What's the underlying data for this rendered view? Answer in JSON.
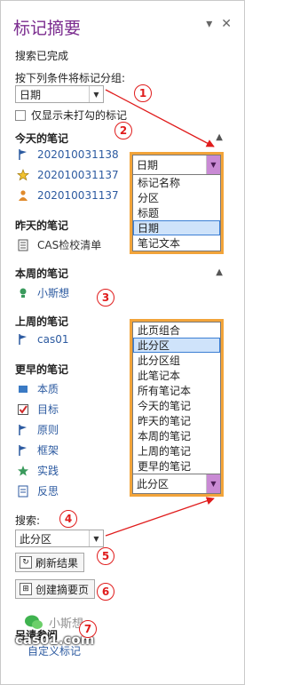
{
  "pane": {
    "title": "标记摘要",
    "pin_glyph": "▾",
    "close_glyph": "✕"
  },
  "status": "搜索已完成",
  "group_by": {
    "label": "按下列条件将标记分组:",
    "value": "日期"
  },
  "unchecked_only_label": "仅显示未打勾的标记",
  "sections": {
    "today": "今天的笔记",
    "yesterday": "昨天的笔记",
    "this_week": "本周的笔记",
    "last_week": "上周的笔记",
    "older": "更早的笔记"
  },
  "today_items": [
    "202010031138",
    "202010031137",
    "202010031137"
  ],
  "yesterday_items": [
    "CAS检校清单"
  ],
  "this_week_items": [
    "小斯想"
  ],
  "last_week_items": [
    "cas01"
  ],
  "older_items": [
    "本质",
    "目标",
    "原则",
    "框架",
    "实践",
    "反思"
  ],
  "group_dropdown": {
    "value": "日期",
    "options": [
      "标记名称",
      "分区",
      "标题",
      "日期",
      "笔记文本"
    ],
    "selected_index": 3
  },
  "scope_dropdown": {
    "options": [
      "此页组合",
      "此分区",
      "此分区组",
      "此笔记本",
      "所有笔记本",
      "今天的笔记",
      "昨天的笔记",
      "本周的笔记",
      "上周的笔记",
      "更早的笔记"
    ],
    "selected_index": 1,
    "value": "此分区"
  },
  "search": {
    "label": "搜索:",
    "value": "此分区"
  },
  "buttons": {
    "refresh": "刷新结果",
    "create": "创建摘要页"
  },
  "see_also": {
    "label": "另请参阅",
    "link": "自定义标记"
  },
  "watermark": {
    "line1": "小斯想",
    "line2": "cas01.com"
  },
  "markers": [
    "1",
    "2",
    "3",
    "4",
    "5",
    "6",
    "7"
  ],
  "colors": {
    "title": "#7b2c8f",
    "link": "#2c5aa0",
    "annotation": "#e01c1c",
    "highlight_border": "#f2a43a",
    "selected_fill": "#cfe3fa"
  }
}
